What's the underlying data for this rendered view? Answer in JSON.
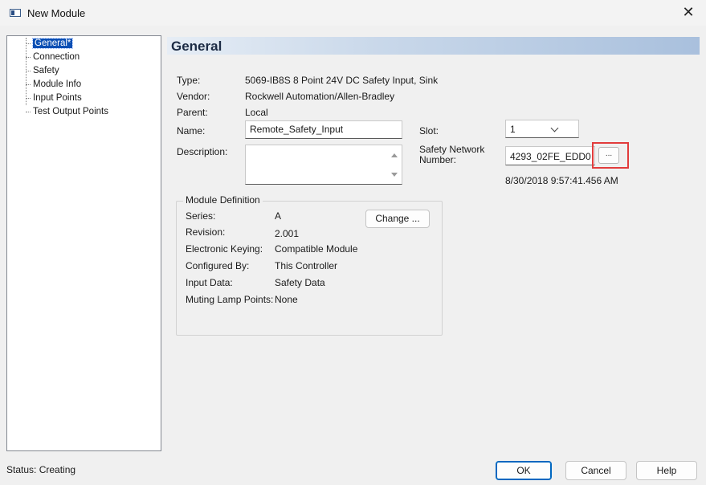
{
  "window": {
    "title": "New Module",
    "close_glyph": "✕"
  },
  "tree": {
    "items": [
      {
        "label": "General*",
        "selected": true
      },
      {
        "label": "Connection",
        "selected": false
      },
      {
        "label": "Safety",
        "selected": false
      },
      {
        "label": "Module Info",
        "selected": false
      },
      {
        "label": "Input Points",
        "selected": false
      },
      {
        "label": "Test Output Points",
        "selected": false
      }
    ]
  },
  "panel": {
    "header": "General",
    "type_label": "Type:",
    "type_value": "5069-IB8S 8 Point 24V DC Safety Input, Sink",
    "vendor_label": "Vendor:",
    "vendor_value": "Rockwell Automation/Allen-Bradley",
    "parent_label": "Parent:",
    "parent_value": "Local",
    "name_label": "Name:",
    "name_value": "Remote_Safety_Input",
    "description_label": "Description:",
    "description_value": "",
    "slot_label": "Slot:",
    "slot_value": "1",
    "snn_label_line1": "Safety Network",
    "snn_label_line2": "Number:",
    "snn_value": "4293_02FE_EDD0",
    "snn_button": "...",
    "snn_timestamp": "8/30/2018 9:57:41.456 AM"
  },
  "module_definition": {
    "title": "Module Definition",
    "change_button": "Change ...",
    "rows": [
      {
        "label": "Series:",
        "value": "A"
      },
      {
        "label": "Revision:",
        "value": "2.001"
      },
      {
        "label": "Electronic Keying:",
        "value": "Compatible Module"
      },
      {
        "label": "Configured By:",
        "value": "This Controller"
      },
      {
        "label": "Input Data:",
        "value": "Safety Data"
      },
      {
        "label": "Muting Lamp Points:",
        "value": "None"
      }
    ]
  },
  "footer": {
    "status": "Status:  Creating",
    "ok": "OK",
    "cancel": "Cancel",
    "help": "Help"
  },
  "colors": {
    "selection": "#0b4fb4",
    "highlight_outline": "#e23c3c",
    "default_button_border": "#0067c0"
  }
}
